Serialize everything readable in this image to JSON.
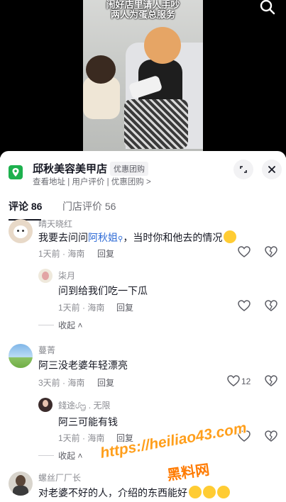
{
  "video": {
    "caption_line1": "闹好店里请人手吵",
    "caption_line2": "两人为蛋总服务"
  },
  "shop": {
    "name": "邱秋美容美甲店",
    "tag": "优惠团购",
    "subtitle": "查看地址 | 用户评价 | 优惠团购 >"
  },
  "tabs": [
    {
      "label": "评论 86"
    },
    {
      "label": "门店评价 56"
    }
  ],
  "comments": [
    {
      "user": "晴天晓红",
      "text_before": "我要去问问",
      "mention": "阿秋姐",
      "text_after": "，当时你和他去的情况",
      "time": "1天前 · 海南",
      "reply": "回复",
      "replies": [
        {
          "user": "柒月",
          "text": "问到给我们吃一下瓜",
          "time": "1天前 · 海南",
          "reply": "回复"
        }
      ],
      "collapse": "收起"
    },
    {
      "user": "蔓菁",
      "text": "阿三没老婆年轻漂亮",
      "time": "3天前 · 海南",
      "reply": "回复",
      "likes": "12",
      "replies": [
        {
          "user": "錢途ᦔᦗ . 无限",
          "text": "阿三可能有钱",
          "time": "1天前 · 海南",
          "reply": "回复"
        }
      ],
      "collapse": "收起"
    },
    {
      "user": "螺丝厂厂长",
      "text": "对老婆不好的人，介绍的东西能好"
    }
  ],
  "watermark": {
    "url": "https://heiliao43.com",
    "name": "黑料网"
  },
  "colors": {
    "accent_link": "#2e6bd6",
    "shop_logo": "#1db14e",
    "watermark": "#ff9f1c"
  }
}
